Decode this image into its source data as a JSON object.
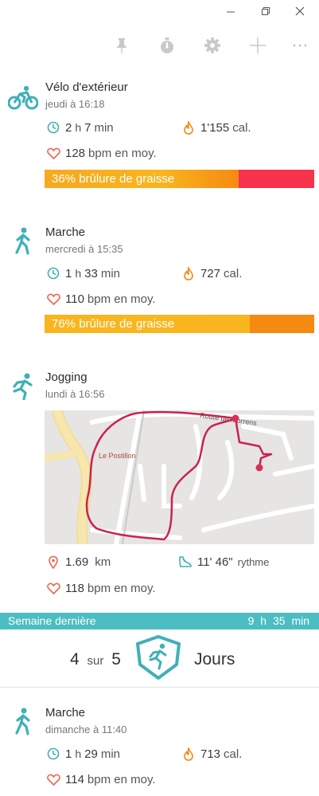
{
  "toolbar": {
    "icons": [
      "pin-icon",
      "stopwatch-icon",
      "gear-icon",
      "plus-icon",
      "more-icon"
    ]
  },
  "activities": [
    {
      "title": "Vélo d'extérieur",
      "date": "jeudi à 16:18",
      "duration_h": "2",
      "duration_h_unit": "h",
      "duration_m": "7",
      "duration_m_unit": "min",
      "calories": "1'155",
      "calories_unit": "cal.",
      "bpm": "128",
      "bpm_unit": "bpm en moy.",
      "fat_burn_label": "36% brûlure de graisse",
      "fat_burn_fraction": 0.72
    },
    {
      "title": "Marche",
      "date": "mercredi à 15:35",
      "duration_h": "1",
      "duration_h_unit": "h",
      "duration_m": "33",
      "duration_m_unit": "min",
      "calories": "727",
      "calories_unit": "cal.",
      "bpm": "110",
      "bpm_unit": "bpm en moy.",
      "fat_burn_label": "76% brûlure de graisse",
      "fat_burn_fraction": 0.76
    },
    {
      "title": "Jogging",
      "date": "lundi à 16:56",
      "distance": "1.69",
      "distance_unit": "km",
      "pace": "11' 46\"",
      "pace_unit": "rythme",
      "bpm": "118",
      "bpm_unit": "bpm en moy.",
      "map_labels": {
        "road": "Route de Morrens",
        "place": "Le Postillon"
      }
    },
    {
      "title": "Marche",
      "date": "dimanche à 11:40",
      "duration_h": "1",
      "duration_h_unit": "h",
      "duration_m": "29",
      "duration_m_unit": "min",
      "calories": "713",
      "calories_unit": "cal.",
      "bpm": "114",
      "bpm_unit": "bpm en moy."
    }
  ],
  "week": {
    "label": "Semaine dernière",
    "total_h": "9",
    "total_h_unit": "h",
    "total_m": "35",
    "total_m_unit": "min",
    "days_done": "4",
    "days_sep": "sur",
    "days_goal": "5",
    "days_label": "Jours"
  },
  "colors": {
    "accent": "#4bbdc3",
    "icon_teal": "#3fb0b6",
    "heart": "#f0634f",
    "flame": "#f58a12",
    "fat_orange": "#f8b51e",
    "fat_red": "#f7324d",
    "route": "#c8234e"
  }
}
